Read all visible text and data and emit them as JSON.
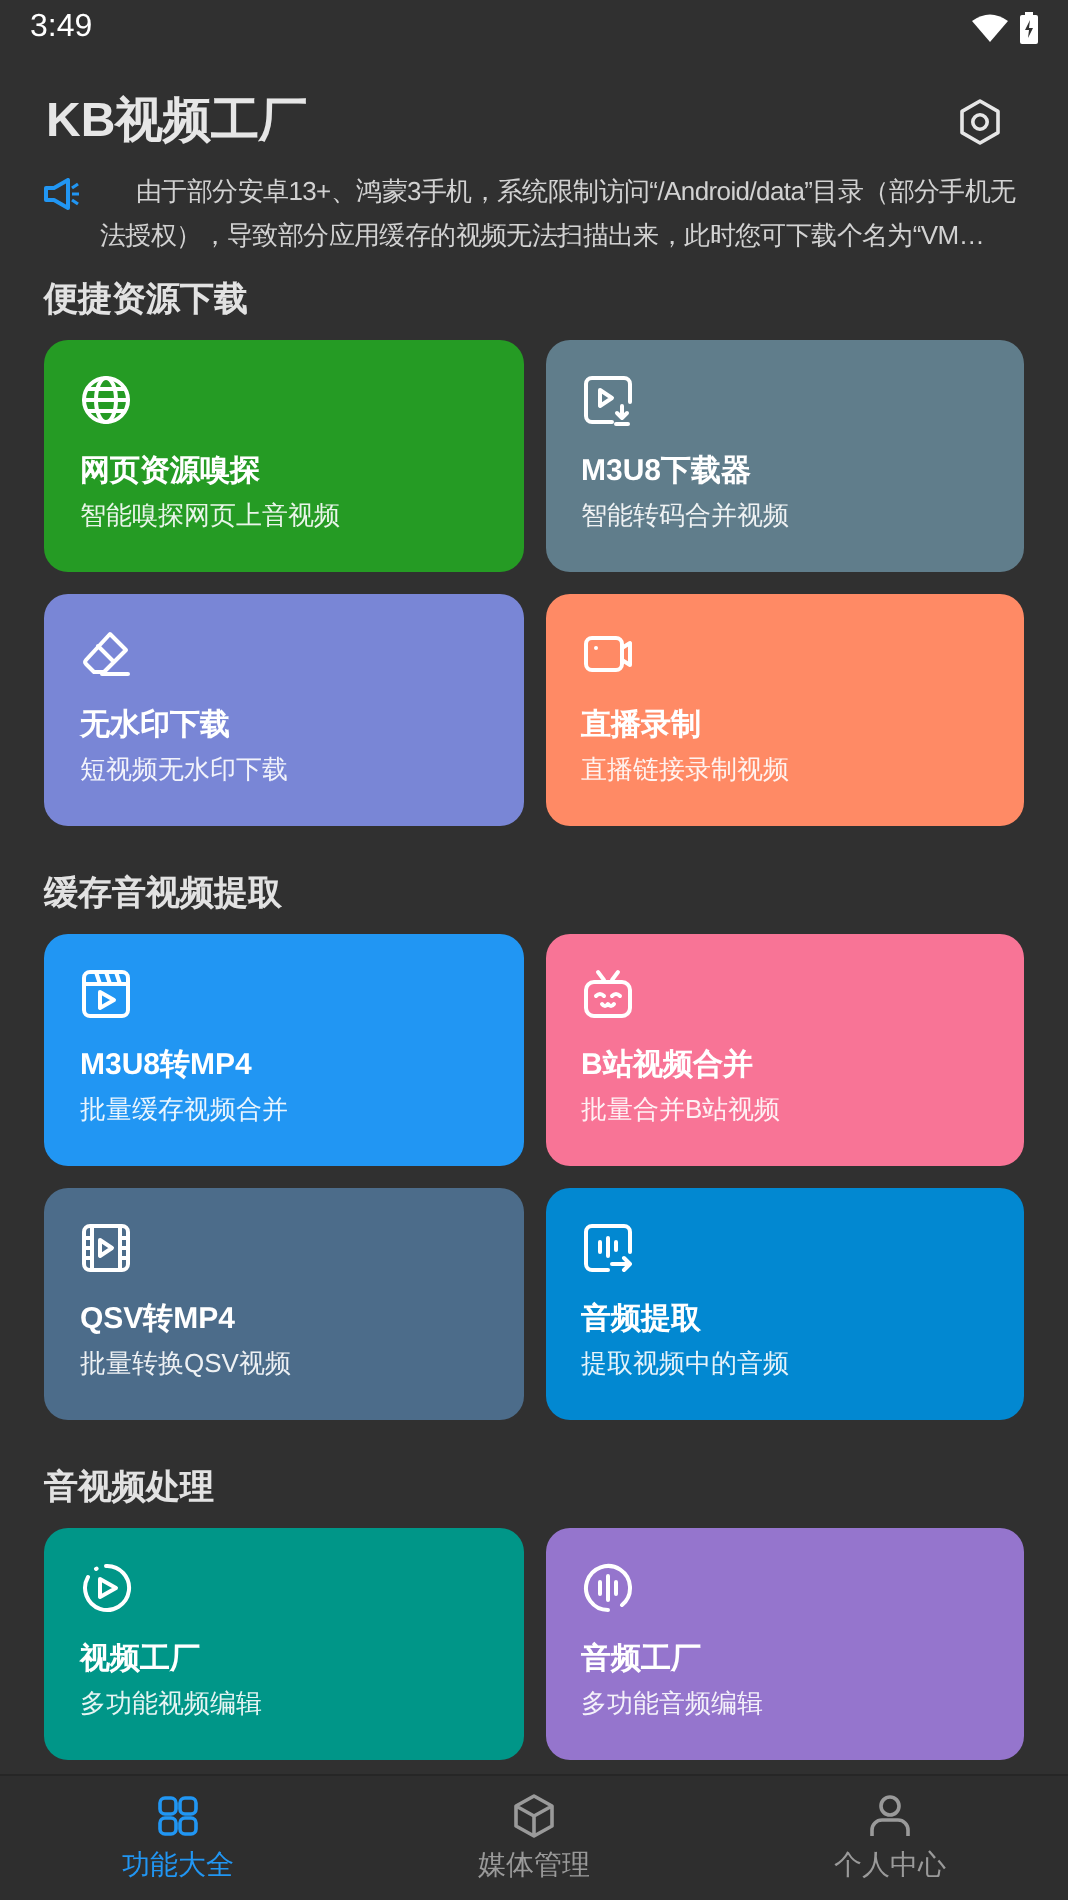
{
  "status_bar": {
    "time": "3:49"
  },
  "app_bar": {
    "title": "KB视频工厂"
  },
  "notice": {
    "text": "由于部分安卓13+、鸿蒙3手机，系统限制访问“/Android/data”目录（部分手机无法授权），导致部分应用缓存的视频无法扫描出来，此时您可下载个名为“VM…"
  },
  "sections": [
    {
      "title": "便捷资源下载",
      "cards": [
        {
          "kind": "globe",
          "title": "网页资源嗅探",
          "subtitle": "智能嗅探网页上音视频",
          "color": "#259b24"
        },
        {
          "kind": "download",
          "title": "M3U8下载器",
          "subtitle": "智能转码合并视频",
          "color": "#607d8b"
        },
        {
          "kind": "eraser",
          "title": "无水印下载",
          "subtitle": "短视频无水印下载",
          "color": "#7986d6"
        },
        {
          "kind": "camera",
          "title": "直播录制",
          "subtitle": "直播链接录制视频",
          "color": "#ff8a65"
        }
      ]
    },
    {
      "title": "缓存音视频提取",
      "cards": [
        {
          "kind": "clapper",
          "title": "M3U8转MP4",
          "subtitle": "批量缓存视频合并",
          "color": "#2196f3"
        },
        {
          "kind": "tv",
          "title": "B站视频合并",
          "subtitle": "批量合并B站视频",
          "color": "#f87496"
        },
        {
          "kind": "film",
          "title": "QSV转MP4",
          "subtitle": "批量转换QSV视频",
          "color": "#4c6c8a"
        },
        {
          "kind": "audio",
          "title": "音频提取",
          "subtitle": "提取视频中的音频",
          "color": "#0288d1"
        }
      ]
    },
    {
      "title": "音视频处理",
      "cards": [
        {
          "kind": "play",
          "title": "视频工厂",
          "subtitle": "多功能视频编辑",
          "color": "#009688"
        },
        {
          "kind": "wave",
          "title": "音频工厂",
          "subtitle": "多功能音频编辑",
          "color": "#9575cd"
        }
      ]
    }
  ],
  "bottom_nav": [
    {
      "kind": "grid",
      "label": "功能大全",
      "selected": true
    },
    {
      "kind": "cube",
      "label": "媒体管理",
      "selected": false
    },
    {
      "kind": "person",
      "label": "个人中心",
      "selected": false
    }
  ]
}
